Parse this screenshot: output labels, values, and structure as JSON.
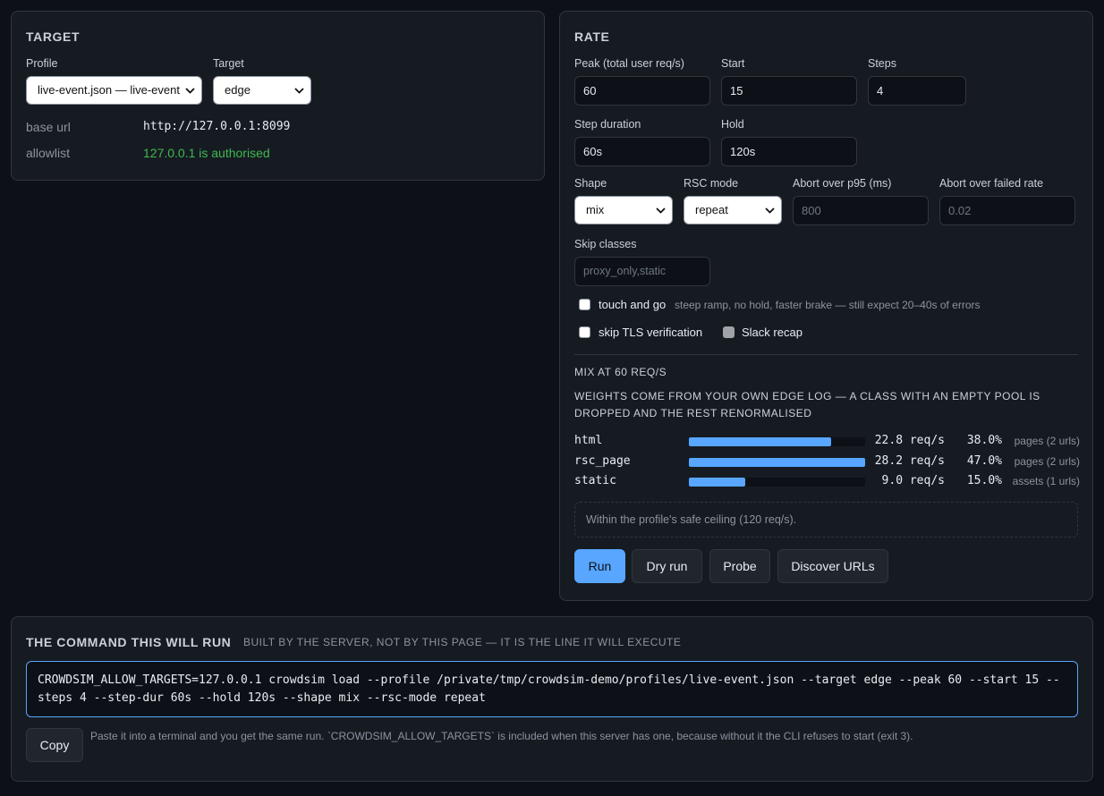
{
  "target": {
    "heading": "TARGET",
    "profile_label": "Profile",
    "profile_value": "live-event.json — live-event",
    "target_label": "Target",
    "target_value": "edge",
    "base_url_key": "base url",
    "base_url_value": "http://127.0.0.1:8099",
    "allowlist_key": "allowlist",
    "allowlist_value": "127.0.0.1 is authorised"
  },
  "rate": {
    "heading": "RATE",
    "peak_label": "Peak (total user req/s)",
    "peak_value": "60",
    "start_label": "Start",
    "start_value": "15",
    "steps_label": "Steps",
    "steps_value": "4",
    "step_duration_label": "Step duration",
    "step_duration_value": "60s",
    "hold_label": "Hold",
    "hold_value": "120s",
    "shape_label": "Shape",
    "shape_value": "mix",
    "rsc_mode_label": "RSC mode",
    "rsc_mode_value": "repeat",
    "abort_p95_label": "Abort over p95 (ms)",
    "abort_p95_placeholder": "800",
    "abort_failed_label": "Abort over failed rate",
    "abort_failed_placeholder": "0.02",
    "skip_classes_label": "Skip classes",
    "skip_classes_placeholder": "proxy_only,static",
    "touch_and_go_label": "touch and go",
    "touch_and_go_hint": "steep ramp, no hold, faster brake — still expect 20–40s of errors",
    "touch_and_go_checked": false,
    "skip_tls_label": "skip TLS verification",
    "skip_tls_checked": false,
    "slack_recap_label": "Slack recap",
    "slack_recap_checked": false
  },
  "mix": {
    "title": "MIX AT 60 REQ/S",
    "description": "WEIGHTS COME FROM YOUR OWN EDGE LOG — A CLASS WITH AN EMPTY POOL IS DROPPED AND THE REST RENORMALISED",
    "rows": [
      {
        "name": "html",
        "rate": "22.8 req/s",
        "percent": "38.0%",
        "note": "pages (2 urls)",
        "fill": 0.808
      },
      {
        "name": "rsc_page",
        "rate": "28.2 req/s",
        "percent": "47.0%",
        "note": "pages (2 urls)",
        "fill": 1.0
      },
      {
        "name": "static",
        "rate": "9.0 req/s",
        "percent": "15.0%",
        "note": "assets (1 urls)",
        "fill": 0.319
      }
    ],
    "notice": "Within the profile's safe ceiling (120 req/s)."
  },
  "actions": {
    "run": "Run",
    "dry_run": "Dry run",
    "probe": "Probe",
    "discover": "Discover URLs"
  },
  "command": {
    "heading": "THE COMMAND THIS WILL RUN",
    "subheading": "BUILT BY THE SERVER, NOT BY THIS PAGE — IT IS THE LINE IT WILL EXECUTE",
    "text": "CROWDSIM_ALLOW_TARGETS=127.0.0.1 crowdsim load --profile /private/tmp/crowdsim-demo/profiles/live-event.json --target edge --peak 60 --start 15 --steps 4 --step-dur 60s --hold 120s --shape mix --rsc-mode repeat",
    "copy_label": "Copy",
    "hint": "Paste it into a terminal and you get the same run. `CROWDSIM_ALLOW_TARGETS` is included when this server has one, because without it the CLI refuses to start (exit 3)."
  },
  "colors": {
    "accent": "#58a6ff",
    "success": "#3fb950",
    "background": "#0d1117",
    "panel": "#161b22"
  }
}
